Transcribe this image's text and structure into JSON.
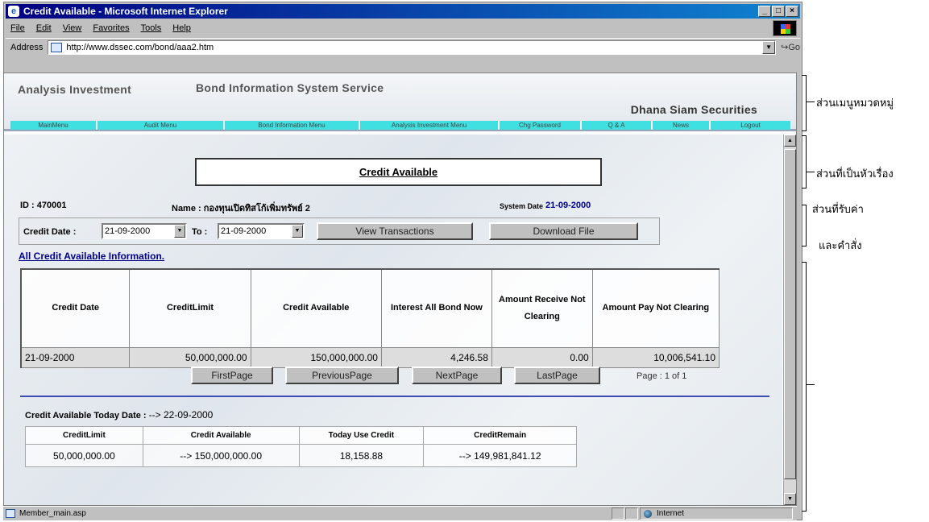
{
  "window": {
    "title": "Credit Available - Microsoft Internet Explorer",
    "min_label": "_",
    "max_label": "□",
    "close_label": "×"
  },
  "menu": [
    "File",
    "Edit",
    "View",
    "Favorites",
    "Tools",
    "Help"
  ],
  "address": {
    "label": "Address",
    "url": "http://www.dssec.com/bond/aaa2.htm",
    "go_label": "Go"
  },
  "site": {
    "left": "Analysis Investment",
    "center": "Bond Information System Service",
    "right": "Dhana Siam Securities",
    "nav": [
      "MainMenu",
      "Audit Menu",
      "Bond Information Menu",
      "Analysis Investment Menu",
      "Chg Password",
      "Q & A",
      "News",
      "Logout"
    ]
  },
  "page": {
    "title": "Credit Available",
    "id_label": "ID : 470001",
    "name_label": "Name : กองทุนเปิดทิสโก้เพิ่มทรัพย์ 2",
    "sys_date_label": "System Date",
    "sys_date": "21-09-2000",
    "credit_date_label": "Credit Date :",
    "credit_date": "21-09-2000",
    "to_label": "To :",
    "to_date": "21-09-2000",
    "view_btn": "View Transactions",
    "download_btn": "Download File",
    "all_info": "All Credit Available Information."
  },
  "main_table": {
    "headers": [
      "Credit Date",
      "CreditLimit",
      "Credit Available",
      "Interest All Bond Now",
      "Amount Receive Not Clearing",
      "Amount Pay Not Clearing"
    ],
    "row": [
      "21-09-2000",
      "50,000,000.00",
      "150,000,000.00",
      "4,246.58",
      "0.00",
      "10,006,541.10"
    ]
  },
  "pager": {
    "first": "FirstPage",
    "prev": "PreviousPage",
    "next": "NextPage",
    "last": "LastPage",
    "page_info": "Page : 1 of 1"
  },
  "today": {
    "label": "Credit Available Today Date :",
    "date": "--> 22-09-2000",
    "headers": [
      "CreditLimit",
      "Credit Available",
      "Today Use Credit",
      "CreditRemain"
    ],
    "row": [
      "50,000,000.00",
      "--> 150,000,000.00",
      "18,158.88",
      "--> 149,981,841.12"
    ]
  },
  "status": {
    "text": "Member_main.asp",
    "zone": "Internet"
  },
  "annotations": {
    "menu_section": "ส่วนเมนูหมวดหมู่",
    "title_section": "ส่วนที่เป็นหัวเรื่อง",
    "input_section_1": "ส่วนที่รับค่า",
    "input_section_2": "และคำสั่ง"
  }
}
